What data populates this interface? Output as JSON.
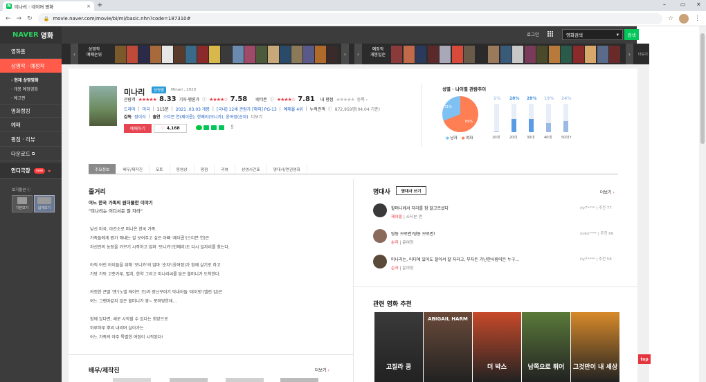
{
  "browser": {
    "tab_title": "미나리 : 네이버 영화",
    "url": "movie.naver.com/movie/bi/mi/basic.nhn?code=187310#",
    "new_tab": "+",
    "close": "×"
  },
  "lnb": {
    "logo_naver": "NAVER",
    "logo_movie": "영화",
    "items": [
      "영화홈",
      "상영작 · 예정작"
    ],
    "subs": [
      "현재 상영영화",
      "개봉 예정영화",
      "예고편"
    ],
    "items2": [
      "영화랭킹",
      "예매",
      "평점 · 리뷰",
      "다운로드"
    ],
    "indie": "인디극장",
    "indie_badge": "new",
    "view_option": "보기옵션",
    "view_basic": "기본보기",
    "view_wide": "넓게보기"
  },
  "top": {
    "login": "로그인",
    "search_select": "영화검색",
    "search_btn": "검색"
  },
  "strip": {
    "label_now": "상영작\n예매순위",
    "label_upcoming": "예정작\n개봉일순",
    "more": "더보기",
    "poster_colors": [
      "#7a5a2a",
      "#c04a3a",
      "#2a2a4a",
      "#a86a3a",
      "#e6e6e6",
      "#5a3a2a",
      "#3a6a8a",
      "#8a2a2a",
      "#d8b84a",
      "#3a3a3a",
      "#6a8ab0",
      "#a04a6a",
      "#4a5a3a",
      "#c8a878",
      "#2a4a6a",
      "#8a7a5a",
      "#5a5a8a",
      "#b06a2a",
      "#3a2a2a"
    ],
    "poster_colors2": [
      "#8a3a3a",
      "#c06a4a",
      "#2a3a5a",
      "#5a2a2a",
      "#a8a8b8",
      "#d84a3a",
      "#6a5a4a",
      "#2a2a2a",
      "#9a7a5a",
      "#3a5a7a",
      "#c8c8c8",
      "#7a3a5a",
      "#4a4a2a",
      "#b87a3a",
      "#2a5a4a",
      "#8a2a2a",
      "#d8a86a",
      "#5a6a8a",
      "#6a2a2a"
    ]
  },
  "movie": {
    "title": "미나리",
    "status": "상영중",
    "sub": "Minari , 2020",
    "audience_label": "관람객",
    "audience_score": "8.33",
    "critic_label": "기자·평론가",
    "critic_score": "7.58",
    "netizen_label": "네티즌",
    "netizen_score": "7.81",
    "my_label": "내 평점",
    "my_register": "등록",
    "genre": "드라마",
    "country": "미국",
    "runtime": "115분",
    "release": "2021 .03.03 개봉",
    "rating_kr": "[국내] 12세 관람가 [해외] PG-13",
    "reserve": "예매율 4위",
    "cumulative": "누적관객",
    "cumulative_val": "872,959명(04.04 기준)",
    "director_label": "감독",
    "director": "정이삭",
    "cast_label": "출연",
    "cast": "스티븐 연(제이콥), 한예리(모니카), 윤여정(순자)",
    "more": "더보기",
    "book": "예매하기",
    "likes": "4,168"
  },
  "stats": {
    "title": "성별 · 나이별 관람추이",
    "male_pct": "31%",
    "female_pct": "69%",
    "male": "남자",
    "female": "여자",
    "ages": [
      {
        "label": "10대",
        "pct": "1%",
        "value": 1
      },
      {
        "label": "20대",
        "pct": "28%",
        "value": 28
      },
      {
        "label": "30대",
        "pct": "28%",
        "value": 28
      },
      {
        "label": "40대",
        "pct": "19%",
        "value": 19
      },
      {
        "label": "50대↑",
        "pct": "24%",
        "value": 24
      }
    ]
  },
  "tabs": [
    "주요정보",
    "배우/제작진",
    "포토",
    "동영상",
    "평점",
    "리뷰",
    "상영시간표",
    "명대사/연관영화"
  ],
  "synopsis": {
    "heading": "줄거리",
    "sub1": "어느 한국 가족의 원더풀한 이야기",
    "sub2": "\"미나리는 어디서든 잘 자라\"",
    "lines": [
      "낯선 미국, 아칸소로 떠나온 한국 가족.",
      "가족들에게 뭔가 해내는 걸 보여주고 싶은 아빠 '제이콥'(스티븐 연)은",
      "자신만의 농장을 가꾸기 시작하고 엄마 '모니카'(한예리)도 다시 일자리를 찾는다.",
      "",
      "아직 어린 아이들을 위해 '모니카'의 엄마 '순자'(윤여정)가 함께 살기로 하고",
      "가방 가득 고춧가루, 멸치, 한약 그리고 미나리씨를 담은 할머니가 도착한다.",
      "",
      "의젓한 큰딸 '앤'(노엘 케이트 조)과 장난꾸러기 막내아들 '데이빗'(앨런 김)은",
      "여느 그랜마같지 않은 할머니가 영~ 못마땅한데…",
      "",
      "함께 있다면, 새로 시작할 수 있다는 희망으로",
      "하루하루 뿌리 내리며 살아가는",
      "어느 가족의 아주 특별한 여정이 시작된다!"
    ]
  },
  "cast_section": {
    "heading": "배우/제작진",
    "more": "더보기"
  },
  "quotes": {
    "heading": "명대사",
    "btn": "명대사 쓰기",
    "more": "더보기",
    "items": [
      {
        "text": "할머니께서 자리를 참 잘고르셨다",
        "who": "제이콥",
        "actor": "스티븐 연",
        "user": "rly7****",
        "rec": "추천",
        "count": "77"
      },
      {
        "text": "띵동 브로콴!띵동 브로콴!",
        "who": "순자",
        "actor": "윤여정",
        "user": "ooko****",
        "rec": "추천",
        "count": "66"
      },
      {
        "text": "미나리는, 어디에 있어도 잘아서 잘 자라고, 부자든 가난한사람이든 누구…",
        "who": "순자",
        "actor": "윤여정",
        "user": "rly7****",
        "rec": "추천",
        "count": "58"
      }
    ]
  },
  "related": {
    "heading": "관련 영화 추천",
    "posters": [
      {
        "text": "고질라 콩",
        "color": "#3a3a3a"
      },
      {
        "text": "ABIGAIL HARM",
        "color": "#6a4a3a"
      },
      {
        "text": "더 박스",
        "color": "#c84a2a"
      },
      {
        "text": "남쪽으로 튀어",
        "color": "#5a7a3a"
      },
      {
        "text": "그것만이 내 세상",
        "color": "#d88a2a"
      }
    ]
  },
  "top_btn": "top"
}
